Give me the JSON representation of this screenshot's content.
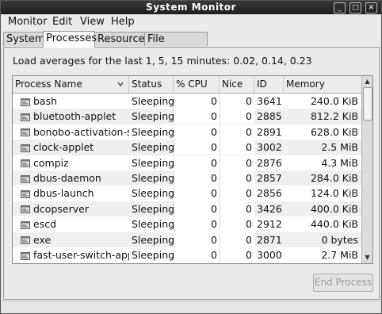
{
  "window": {
    "title": "System Monitor",
    "buttons": [
      "_",
      "□",
      "✕"
    ]
  },
  "menubar": {
    "items": [
      "Monitor",
      "Edit",
      "View",
      "Help"
    ]
  },
  "tabs": [
    {
      "label": "System",
      "active": false
    },
    {
      "label": "Processes",
      "active": true
    },
    {
      "label": "Resources",
      "active": false
    },
    {
      "label": "File Systems",
      "active": false
    }
  ],
  "load": {
    "text": "Load averages for the last 1, 5, 15 minutes: 0.02, 0.14, 0.23"
  },
  "table": {
    "headers": [
      "Process Name",
      "Status",
      "% CPU",
      "Nice",
      "ID",
      "Memory"
    ],
    "sort_icon": "chevron-down-icon",
    "rows": [
      {
        "name": "bash",
        "status": "Sleeping",
        "cpu": "0",
        "nice": "0",
        "id": "3641",
        "mem": "240.0 KiB"
      },
      {
        "name": "bluetooth-applet",
        "status": "Sleeping",
        "cpu": "0",
        "nice": "0",
        "id": "2885",
        "mem": "812.2 KiB"
      },
      {
        "name": "bonobo-activation-se",
        "status": "Sleeping",
        "cpu": "0",
        "nice": "0",
        "id": "2891",
        "mem": "628.0 KiB"
      },
      {
        "name": "clock-applet",
        "status": "Sleeping",
        "cpu": "0",
        "nice": "0",
        "id": "3002",
        "mem": "2.5 MiB"
      },
      {
        "name": "compiz",
        "status": "Sleeping",
        "cpu": "0",
        "nice": "0",
        "id": "2876",
        "mem": "4.3 MiB"
      },
      {
        "name": "dbus-daemon",
        "status": "Sleeping",
        "cpu": "0",
        "nice": "0",
        "id": "2857",
        "mem": "284.0 KiB"
      },
      {
        "name": "dbus-launch",
        "status": "Sleeping",
        "cpu": "0",
        "nice": "0",
        "id": "2856",
        "mem": "124.0 KiB"
      },
      {
        "name": "dcopserver",
        "status": "Sleeping",
        "cpu": "0",
        "nice": "0",
        "id": "3426",
        "mem": "400.0 KiB"
      },
      {
        "name": "escd",
        "status": "Sleeping",
        "cpu": "0",
        "nice": "0",
        "id": "2912",
        "mem": "440.0 KiB"
      },
      {
        "name": "exe",
        "status": "Sleeping",
        "cpu": "0",
        "nice": "0",
        "id": "2871",
        "mem": "0 bytes"
      },
      {
        "name": "fast-user-switch-app",
        "status": "Sleeping",
        "cpu": "0",
        "nice": "0",
        "id": "3000",
        "mem": "2.7 MiB"
      }
    ]
  },
  "end_button": {
    "label": "End Process",
    "enabled": false
  }
}
